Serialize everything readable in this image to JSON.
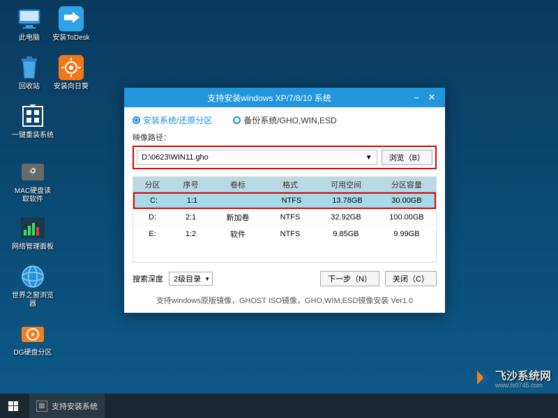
{
  "desktop": {
    "icons": [
      {
        "label": "此电脑"
      },
      {
        "label": "安装ToDesk"
      },
      {
        "label": "回收站"
      },
      {
        "label": "安装向日葵"
      },
      {
        "label": "一键重装系统"
      },
      {
        "label": "MAC硬盘读\n取软件"
      },
      {
        "label": "网络管理面板"
      },
      {
        "label": "世界之窗浏览\n器"
      },
      {
        "label": "DG硬盘分区"
      }
    ]
  },
  "window": {
    "title": "支持安装windows XP/7/8/10 系统",
    "tab_install": "安装系统/还原分区",
    "tab_backup": "备份系统/GHO,WIN,ESD",
    "path_label": "映像路径：",
    "path_value": "D:\\0623\\WIN11.gho",
    "browse": "浏览（B）",
    "columns": {
      "c1": "分区",
      "c2": "序号",
      "c3": "卷标",
      "c4": "格式",
      "c5": "可用空间",
      "c6": "分区容量"
    },
    "rows": [
      {
        "c1": "C:",
        "c2": "1:1",
        "c3": "",
        "c4": "NTFS",
        "c5": "13.78GB",
        "c6": "30.00GB"
      },
      {
        "c1": "D:",
        "c2": "2:1",
        "c3": "新加卷",
        "c4": "NTFS",
        "c5": "32.92GB",
        "c6": "100.00GB"
      },
      {
        "c1": "E:",
        "c2": "1:2",
        "c3": "软件",
        "c4": "NTFS",
        "c5": "9.85GB",
        "c6": "9.99GB"
      }
    ],
    "depth_label": "搜索深度",
    "depth_value": "2级目录",
    "next": "下一步（N）",
    "close": "关闭（C）",
    "footer": "支持windows原版镜像，GHOST ISO镜像，GHO,WIM,ESD镜像安装 Ver1.0"
  },
  "taskbar": {
    "item": "支持安装系统"
  },
  "watermark": {
    "text": "飞沙系统网",
    "sub": "www.fs0745.com"
  }
}
